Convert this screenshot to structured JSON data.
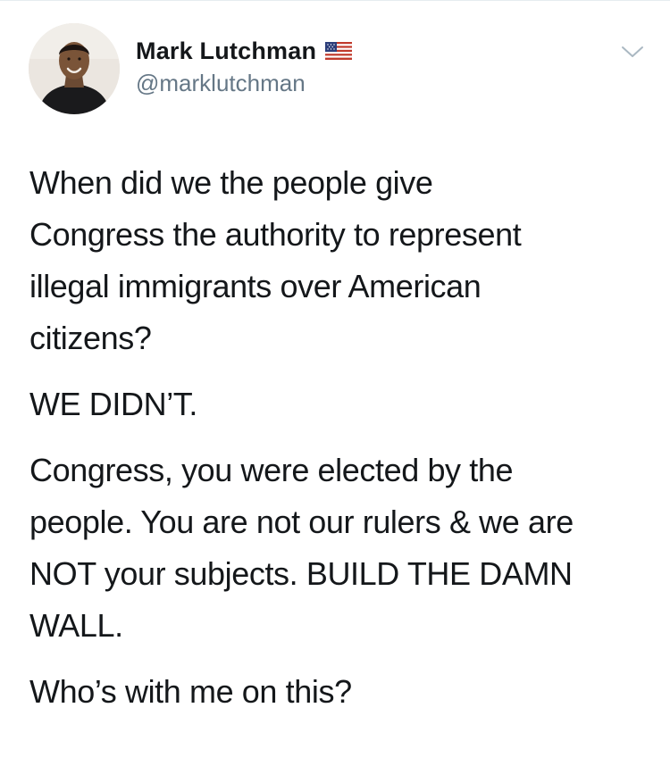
{
  "tweet": {
    "author": {
      "display_name": "Mark Lutchman",
      "handle": "@marklutchman",
      "flag_icon": "us-flag-icon",
      "avatar_icon": "profile-photo"
    },
    "menu_icon": "chevron-down-icon",
    "paragraphs": [
      "When did we the people give\nCongress the authority to represent\nillegal immigrants over American\ncitizens?",
      "WE DIDN’T.",
      "Congress, you were elected by the\npeople. You are not our rulers & we are\nNOT your subjects. BUILD THE DAMN\nWALL.",
      "Who’s with me on this?"
    ]
  },
  "colors": {
    "text": "#14171a",
    "secondary": "#657786",
    "caret": "#aab8c2",
    "divider": "#e6ecf0"
  }
}
